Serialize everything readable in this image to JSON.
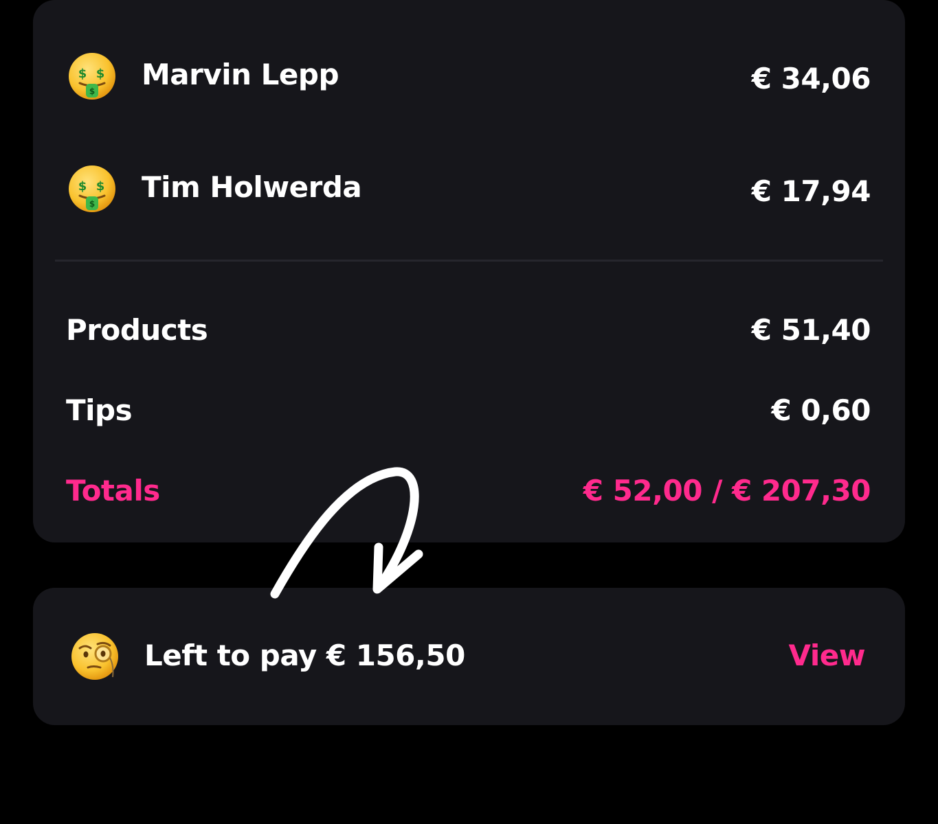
{
  "people": [
    {
      "name": "Marvin Lepp",
      "amount": "€ 34,06",
      "emoji": "money-mouth-face-icon"
    },
    {
      "name": "Tim Holwerda",
      "amount": "€ 17,94",
      "emoji": "money-mouth-face-icon"
    }
  ],
  "summary": {
    "products_label": "Products",
    "products_value": "€ 51,40",
    "tips_label": "Tips",
    "tips_value": "€ 0,60",
    "totals_label": "Totals",
    "totals_value": "€ 52,00 / € 207,30"
  },
  "left_to_pay": {
    "emoji": "face-with-monocle-icon",
    "text": "Left to pay € 156,50",
    "action_label": "View"
  },
  "colors": {
    "background": "#000000",
    "card": "#16161b",
    "accent": "#ff2a8d",
    "text": "#ffffff"
  }
}
